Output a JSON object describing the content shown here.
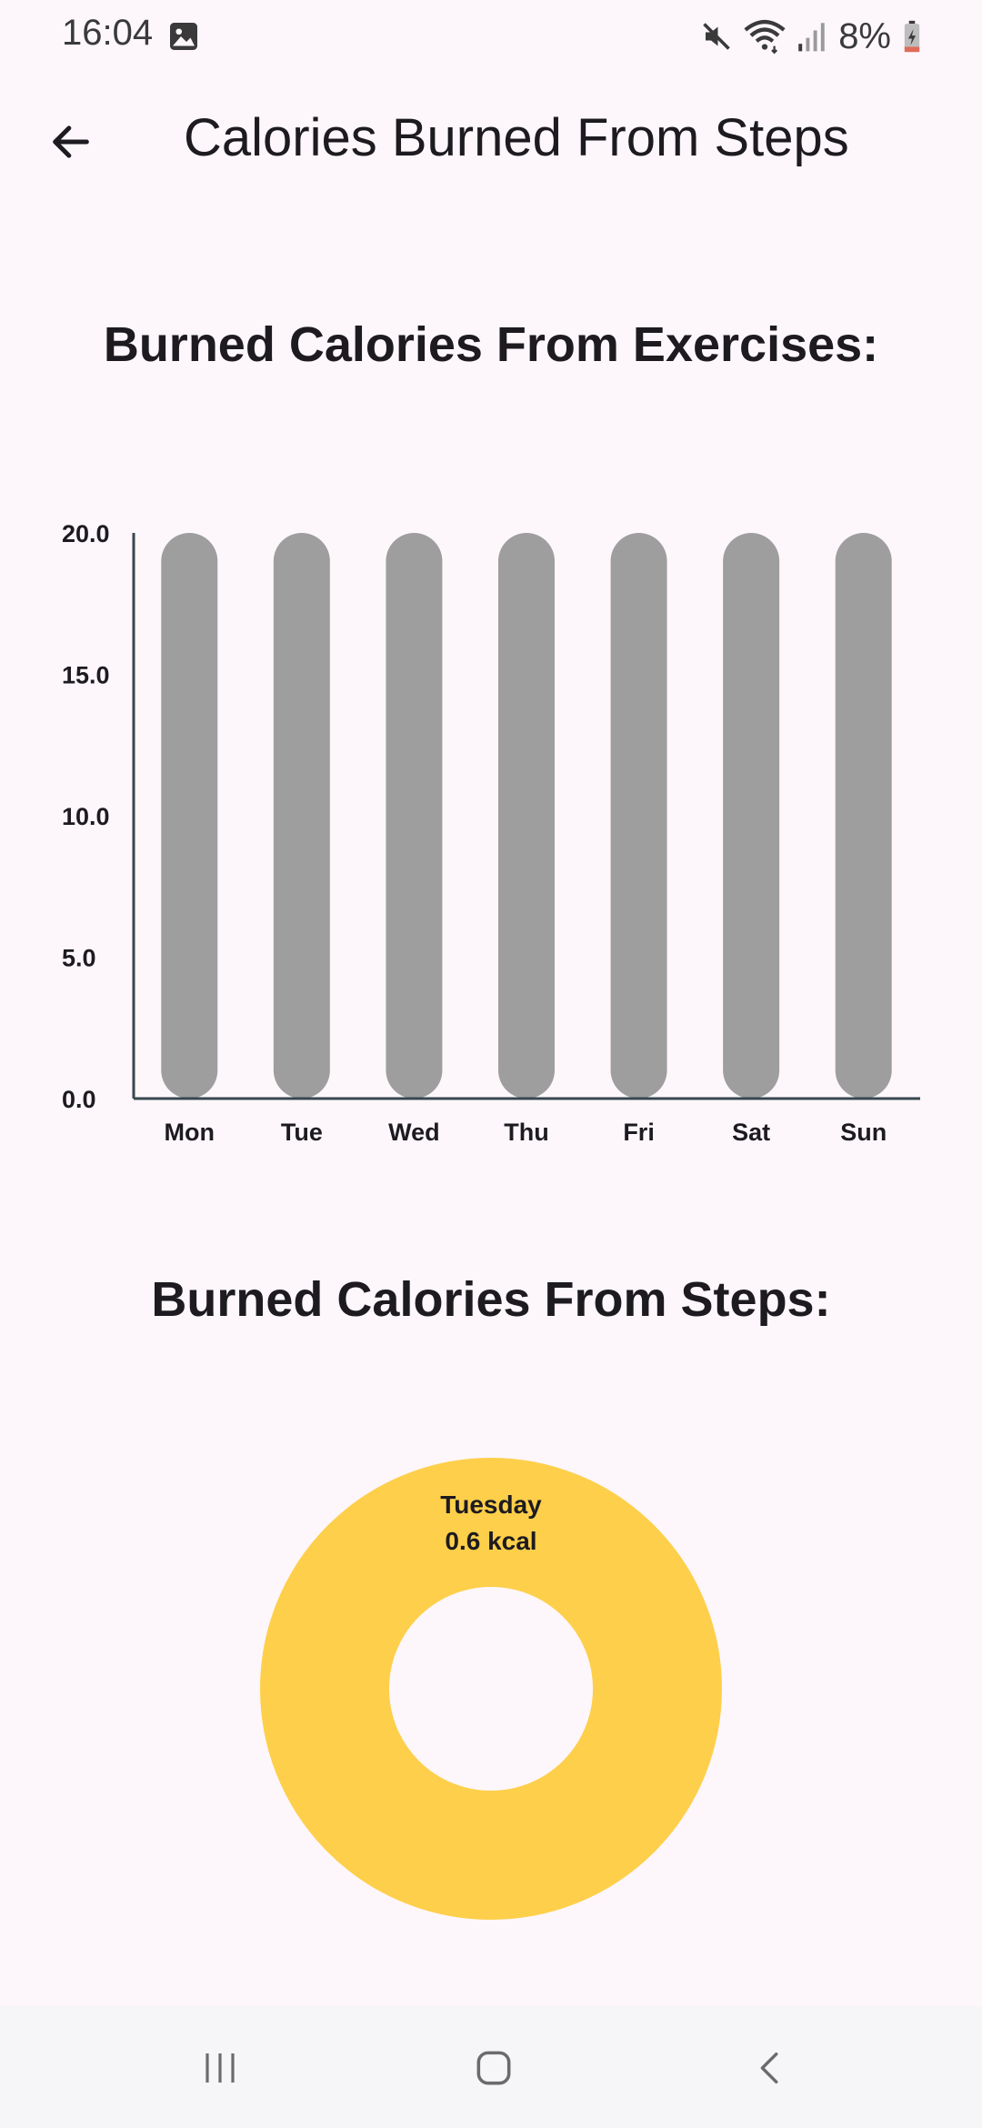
{
  "status_bar": {
    "time": "16:04",
    "battery": "8%",
    "icons": [
      "gallery-icon",
      "mute-icon",
      "wifi-icon",
      "signal-icon",
      "battery-charging-icon"
    ]
  },
  "app_bar": {
    "title": "Calories Burned From Steps",
    "back_icon": "arrow-left-icon"
  },
  "sections": {
    "exercises_heading": "Burned Calories From Exercises:",
    "steps_heading": "Burned Calories From Steps:"
  },
  "chart_data": [
    {
      "type": "bar",
      "categories": [
        "Mon",
        "Tue",
        "Wed",
        "Thu",
        "Fri",
        "Sat",
        "Sun"
      ],
      "values": [
        20,
        20,
        20,
        20,
        20,
        20,
        20
      ],
      "ylim": [
        0,
        20
      ],
      "yticks": [
        "0.0",
        "5.0",
        "10.0",
        "15.0",
        "20.0"
      ],
      "bar_color": "#9e9e9e",
      "grid": false,
      "title": "",
      "xlabel": "",
      "ylabel": ""
    },
    {
      "type": "pie",
      "categories": [
        "Tuesday"
      ],
      "values": [
        0.6
      ],
      "label_day": "Tuesday",
      "label_value": "0.6 kcal",
      "color": "#fecf4a"
    }
  ],
  "nav_bar": {
    "icons": [
      "recent-apps-icon",
      "home-icon",
      "back-icon"
    ]
  },
  "colors": {
    "background": "#fdf7fc",
    "bar": "#9e9e9e",
    "donut": "#fecf4a",
    "axis": "#37474f"
  }
}
